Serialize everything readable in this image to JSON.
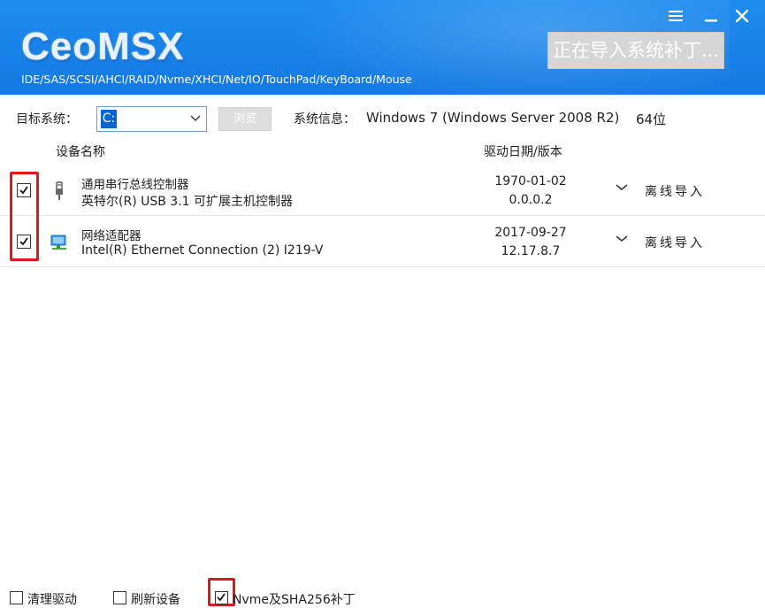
{
  "header": {
    "logo": "CeoMSX",
    "subtitle": "IDE/SAS/SCSI/AHCI/RAID/Nvme/XHCI/Net/IO/TouchPad/KeyBoard/Mouse",
    "import_button_label": "正在导入系统补丁...",
    "menu_icon": "hamburger-icon",
    "minimize_icon": "minimize-icon",
    "close_icon": "close-icon",
    "colors": {
      "primary": "#1479e2",
      "accent_red": "#e0181b"
    }
  },
  "target": {
    "label": "目标系统：",
    "selected_drive": "C:",
    "browse_label": "浏览",
    "sysinfo_label": "系统信息：",
    "os": "Windows 7 (Windows Server 2008 R2)",
    "arch": "64位"
  },
  "columns": {
    "device": "设备名称",
    "driver_date": "驱动日期/版本"
  },
  "devices": [
    {
      "checked": true,
      "icon": "usb-icon",
      "name": "通用串行总线控制器",
      "description": "英特尔(R) USB 3.1 可扩展主机控制器",
      "date": "1970-01-02",
      "version": "0.0.0.2",
      "action": "离线导入"
    },
    {
      "checked": true,
      "icon": "network-adapter-icon",
      "name": "网络适配器",
      "description": "Intel(R) Ethernet Connection (2) I219-V",
      "date": "2017-09-27",
      "version": "12.17.8.7",
      "action": "离线导入"
    }
  ],
  "options": {
    "clean_driver": {
      "label": "清理驱动",
      "checked": false
    },
    "refresh_devices": {
      "label": "刷新设备",
      "checked": false
    },
    "nvme_sha256": {
      "label": "Nvme及SHA256补丁",
      "checked": true
    }
  }
}
